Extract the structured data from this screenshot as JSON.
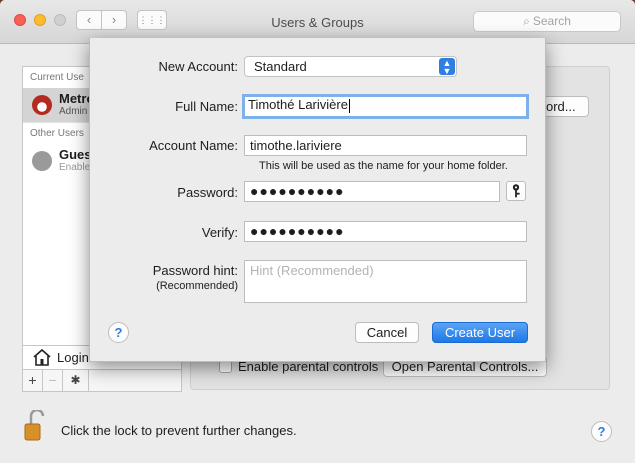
{
  "window": {
    "title": "Users & Groups",
    "search_placeholder": "Search",
    "back_icon": "‹",
    "forward_icon": "›",
    "grid_icon": "⋮⋮⋮"
  },
  "sidebar": {
    "current_users_header": "Current Use",
    "current_user": {
      "name": "Metro",
      "role": "Admin"
    },
    "other_users_header": "Other Users",
    "guest_user": {
      "name": "Gues",
      "role": "Enable"
    },
    "login_options_label": "Login",
    "tools": {
      "add": "+",
      "remove": "−",
      "gear": "✱"
    }
  },
  "main": {
    "reset_password_button": "ord...",
    "parental_controls_label": "Enable parental controls",
    "open_parental_button": "Open Parental Controls...",
    "lock_text": "Click the lock to prevent further changes.",
    "help": "?"
  },
  "sheet": {
    "new_account_label": "New Account:",
    "new_account_value": "Standard",
    "full_name_label": "Full Name:",
    "full_name_value": "Timothé Larivière",
    "account_name_label": "Account Name:",
    "account_name_value": "timothe.lariviere",
    "account_name_note": "This will be used as the name for your home folder.",
    "password_label": "Password:",
    "password_value": "●●●●●●●●●●",
    "verify_label": "Verify:",
    "verify_value": "●●●●●●●●●●",
    "password_hint_label": "Password hint:",
    "password_hint_sublabel": "(Recommended)",
    "password_hint_placeholder": "Hint (Recommended)",
    "help": "?",
    "cancel_button": "Cancel",
    "create_button": "Create User"
  },
  "colors": {
    "accent": "#2f7fe3",
    "focus_ring": "#7eb0ea",
    "close": "#fc5f57",
    "minimize": "#fdbc2e"
  },
  "icons": [
    "close-icon",
    "minimize-icon",
    "zoom-icon",
    "search-icon",
    "home-icon",
    "lock-icon",
    "key-icon",
    "chevron-updown-icon",
    "gear-icon"
  ]
}
